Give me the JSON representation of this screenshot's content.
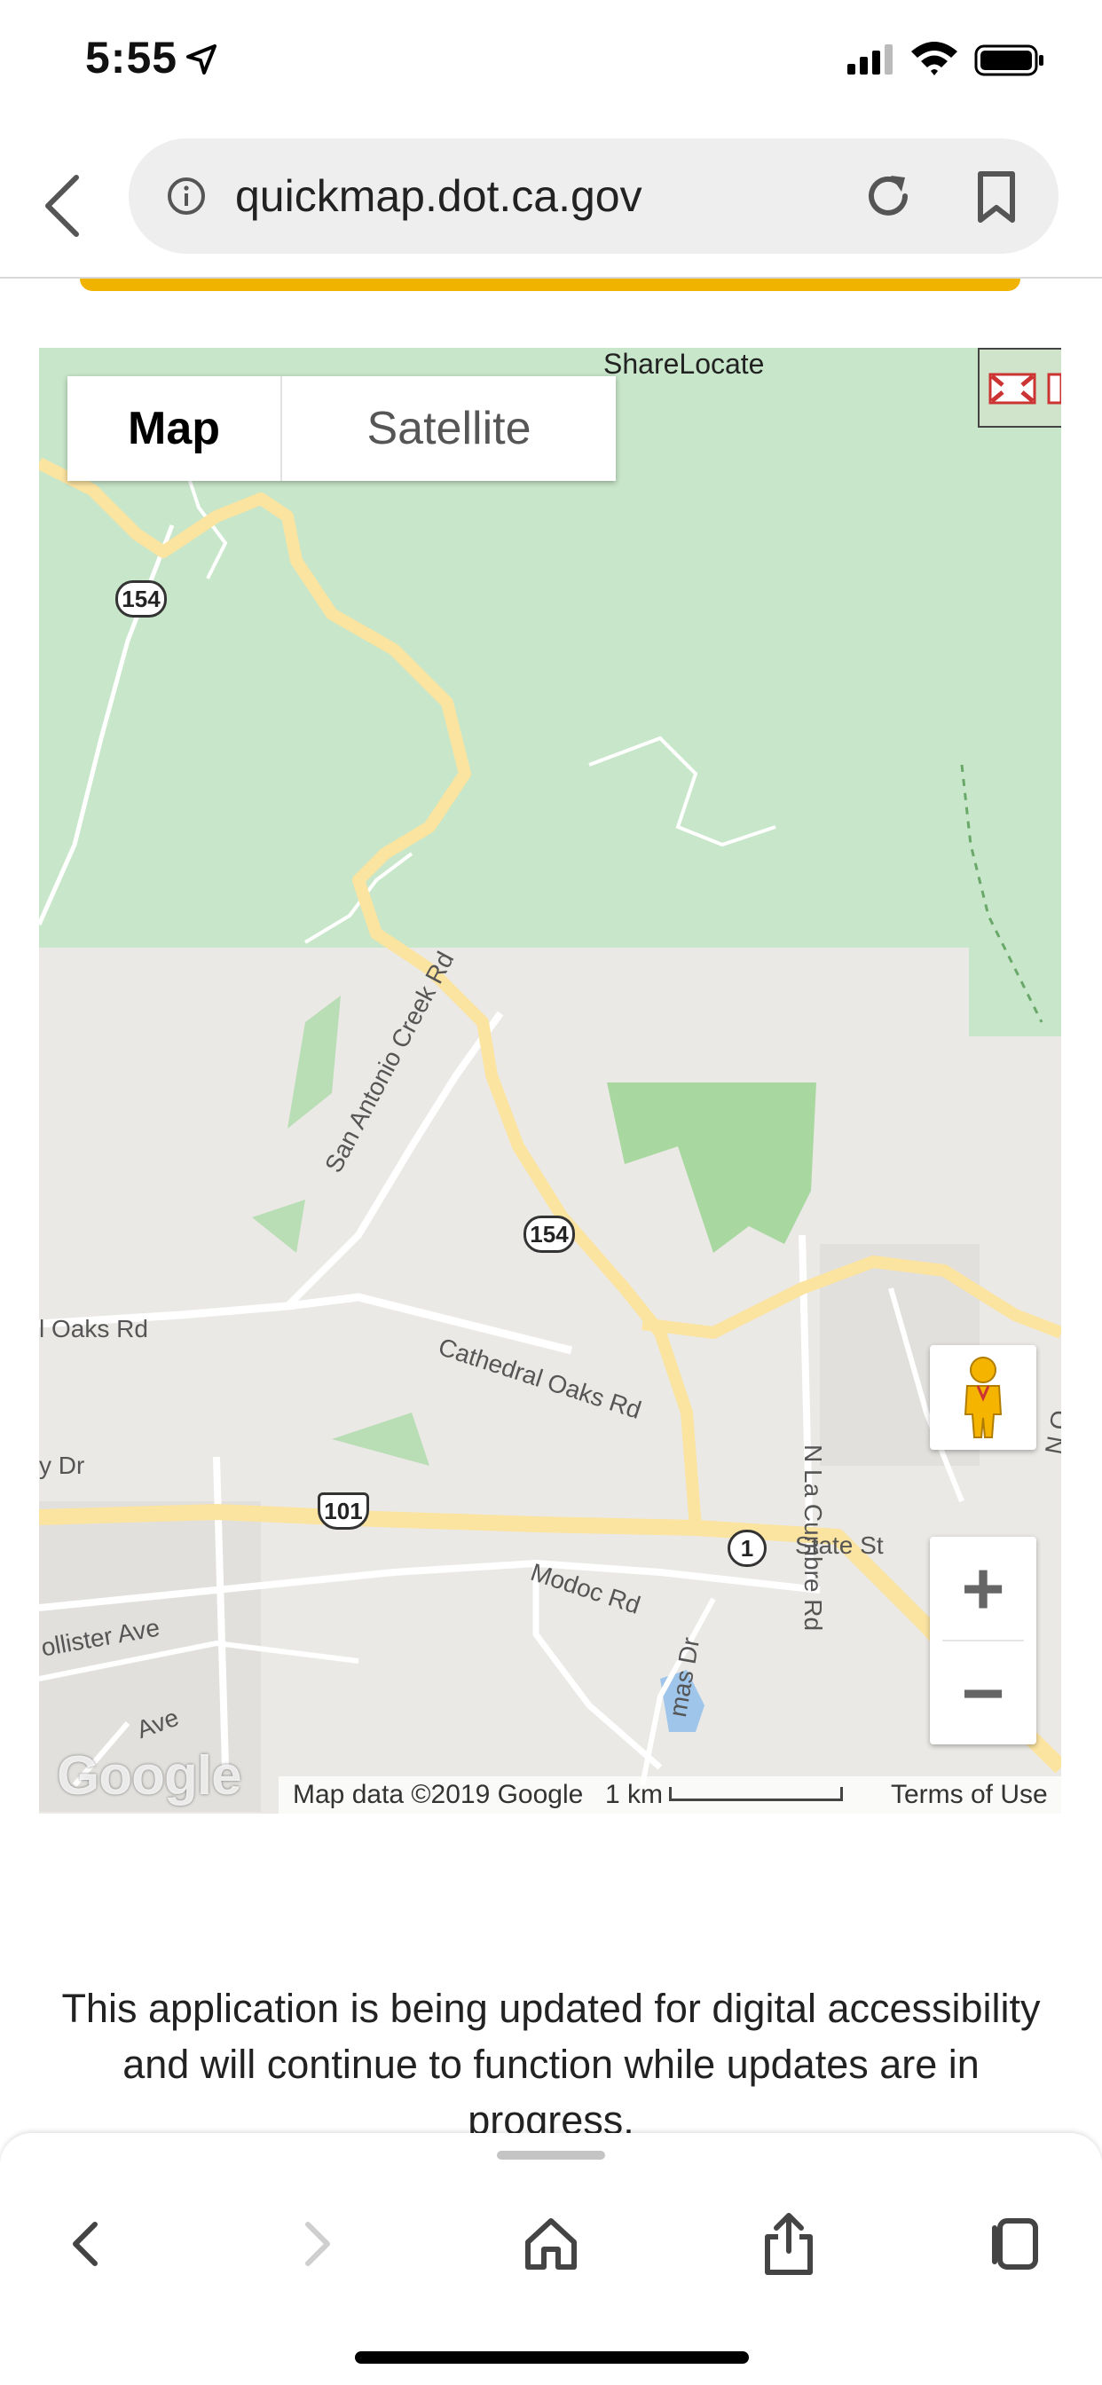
{
  "status_bar": {
    "time": "5:55"
  },
  "browser": {
    "url": "quickmap.dot.ca.gov"
  },
  "map": {
    "type_controls": {
      "map_label": "Map",
      "satellite_label": "Satellite",
      "selected": "Map"
    },
    "share_locate_label": "ShareLocate",
    "zoom": {
      "in_label": "+",
      "out_label": "−"
    },
    "attribution": {
      "logo": "Google",
      "map_data": "Map data ©2019 Google",
      "scale": "1 km",
      "terms": "Terms of Use"
    },
    "road_labels": {
      "oaks_rd": "l Oaks Rd",
      "san_antonio": "San Antonio Creek Rd",
      "cathedral_oaks": "Cathedral Oaks Rd",
      "la_cumbre": "N La Cumbre Rd",
      "state_st": "State St",
      "modoc": "Modoc Rd",
      "hollister": "ollister Ave",
      "y_dr": "y Dr",
      "ave": "Ave",
      "mas_dr": "mas Dr",
      "n_o": "N O"
    },
    "route_shields": {
      "r154_top": "154",
      "r154_mid": "154",
      "r101": "101",
      "r1": "1"
    },
    "colors": {
      "forest": "#c8e6c9",
      "park": "#a8d8a0",
      "land": "#ebe9e6",
      "highway": "#fbe3a0",
      "road": "#ffffff"
    }
  },
  "notice": "This application is being updated for digital accessibility and will continue to function while updates are in progress.",
  "toolbar": {
    "icons": [
      "back-icon",
      "forward-icon",
      "home-icon",
      "share-icon",
      "tabs-icon"
    ]
  }
}
